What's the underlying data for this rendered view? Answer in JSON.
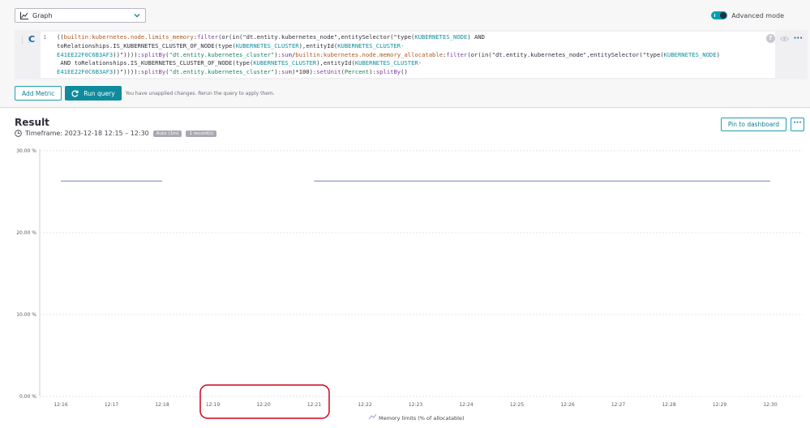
{
  "toolbar": {
    "visualization": "Graph",
    "advanced_mode_label": "Advanced mode",
    "advanced_mode_on": true
  },
  "editor": {
    "query_letter": "C",
    "line_number": "1",
    "help_label": "?",
    "more_label": "···"
  },
  "actions": {
    "add_metric": "Add Metric",
    "run_query": "Run query",
    "unapplied_note": "You have unapplied changes. Rerun the query to apply them."
  },
  "result": {
    "title": "Result",
    "timeframe": "Timeframe: 2023-12-18 12:15 – 12:30",
    "resolution_badge": "Auto (1m)",
    "records_badge": "1 record(s)",
    "pin_label": "Pin to dashboard",
    "more_label": "···"
  },
  "colors": {
    "accent": "#0f8b9c",
    "series": "#8f99d8",
    "highlight": "#d0021b"
  },
  "chart_data": {
    "type": "line",
    "x": [
      "12:16",
      "12:17",
      "12:18",
      "12:19",
      "12:20",
      "12:21",
      "12:22",
      "12:23",
      "12:24",
      "12:25",
      "12:26",
      "12:27",
      "12:28",
      "12:29",
      "12:30"
    ],
    "y_ticks": [
      "0.00 %",
      "10.00 %",
      "20.00 %",
      "30.00 %"
    ],
    "ylim": [
      0,
      30
    ],
    "series": [
      {
        "name": "Memory limits (% of allocatable)",
        "values": [
          26.3,
          26.3,
          26.3,
          null,
          null,
          26.3,
          26.3,
          26.3,
          26.3,
          26.3,
          26.3,
          26.3,
          26.3,
          26.3,
          26.3
        ]
      }
    ],
    "grid": true,
    "legend_position": "bottom"
  }
}
